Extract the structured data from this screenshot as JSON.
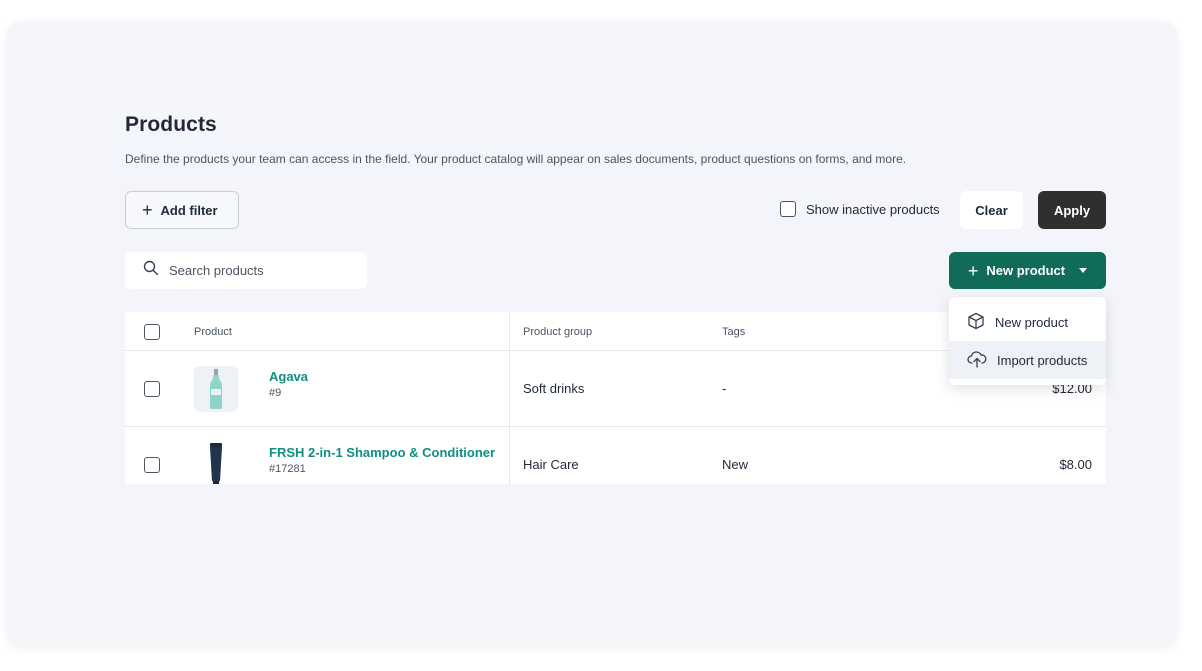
{
  "header": {
    "title": "Products",
    "subtitle": "Define the products your team can access in the field. Your product catalog will appear on sales documents, product questions on forms, and more."
  },
  "filters": {
    "add_filter_label": "Add filter",
    "show_inactive_label": "Show inactive products",
    "clear_label": "Clear",
    "apply_label": "Apply"
  },
  "search": {
    "placeholder": "Search products"
  },
  "new_product_button": {
    "label": "New product"
  },
  "dropdown": {
    "items": [
      {
        "label": "New product",
        "icon": "cube-icon"
      },
      {
        "label": "Import products",
        "icon": "cloud-upload-icon"
      }
    ]
  },
  "table": {
    "columns": [
      "Product",
      "Product group",
      "Tags"
    ],
    "rows": [
      {
        "name": "Agava",
        "sku": "#9",
        "group": "Soft drinks",
        "tags": "-",
        "price": "$12.00"
      },
      {
        "name": "FRSH 2-in-1 Shampoo & Conditioner",
        "sku": "#17281",
        "group": "Hair Care",
        "tags": "New",
        "price": "$8.00"
      }
    ]
  },
  "colors": {
    "brand_green": "#106b58",
    "link_teal": "#0f8f80",
    "apply_dark": "#2f2f2f"
  }
}
